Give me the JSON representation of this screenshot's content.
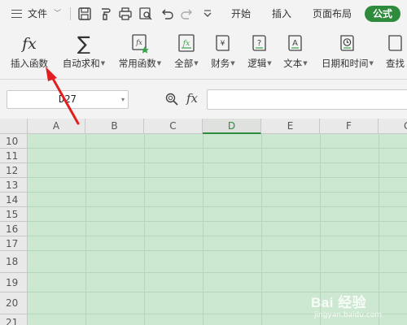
{
  "menubar": {
    "file_label": "文件",
    "tabs": [
      "开始",
      "插入",
      "页面布局",
      "公式"
    ],
    "active_tab": "公式"
  },
  "ribbon": {
    "buttons": [
      {
        "label": "插入函数",
        "icon": "fx-icon",
        "dropdown": false
      },
      {
        "label": "自动求和",
        "icon": "sigma-icon",
        "dropdown": true
      },
      {
        "label": "常用函数",
        "icon": "common-function-icon",
        "dropdown": true
      },
      {
        "label": "全部",
        "icon": "all-functions-icon",
        "dropdown": true
      },
      {
        "label": "财务",
        "icon": "finance-icon",
        "dropdown": true
      },
      {
        "label": "逻辑",
        "icon": "logic-icon",
        "dropdown": true
      },
      {
        "label": "文本",
        "icon": "text-icon",
        "dropdown": true
      },
      {
        "label": "日期和时间",
        "icon": "datetime-icon",
        "dropdown": true
      },
      {
        "label": "查找",
        "icon": "lookup-icon",
        "dropdown": false
      }
    ],
    "icon_glyphs": {
      "fx": "fx",
      "sigma": "∑",
      "yen": "¥",
      "question": "?",
      "a": "A"
    }
  },
  "formula_bar": {
    "name_box": "D27",
    "fx_symbol": "fx",
    "formula": ""
  },
  "sheet": {
    "columns": [
      "A",
      "B",
      "C",
      "D",
      "E",
      "F",
      "G"
    ],
    "selected_column": "D",
    "rows": [
      "10",
      "11",
      "12",
      "13",
      "14",
      "15",
      "16",
      "17",
      "18",
      "19",
      "20",
      "21"
    ],
    "cell_fill": "#cde8d0"
  },
  "colors": {
    "accent": "#2e8b3e",
    "annotation_arrow": "#e02020"
  },
  "watermark": {
    "brand": "Bai 经验",
    "url": "jingyan.baidu.com"
  }
}
